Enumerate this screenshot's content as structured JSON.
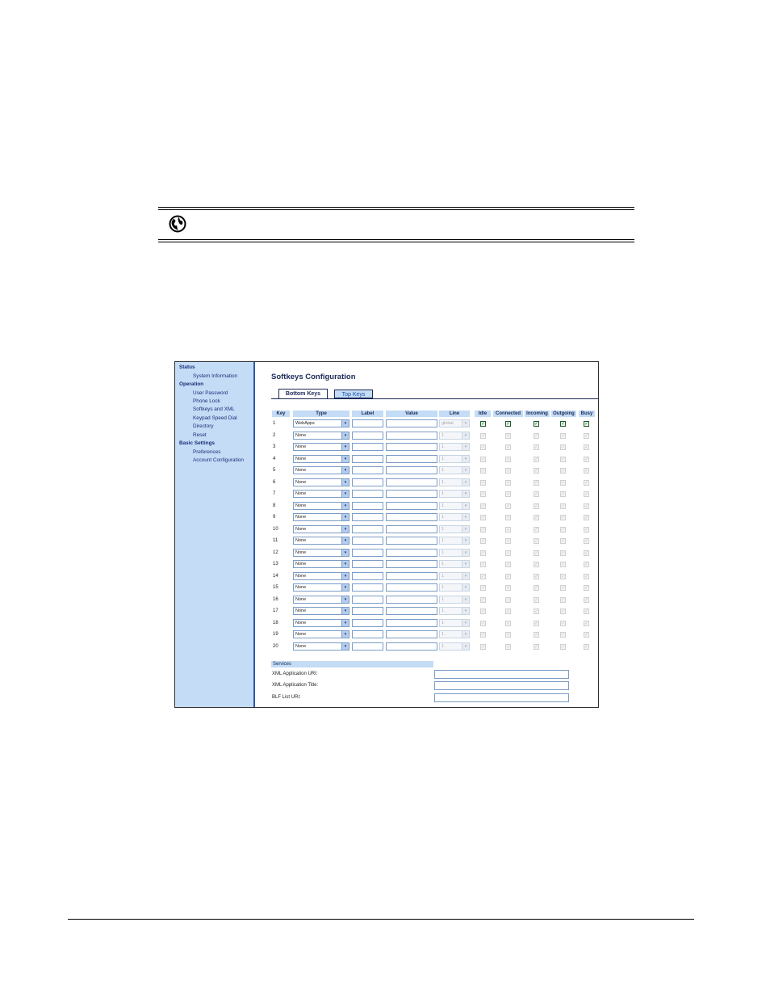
{
  "app": {
    "title": "Softkeys Configuration",
    "tabs": [
      {
        "label": "Bottom Keys",
        "active": true
      },
      {
        "label": "Top Keys",
        "active": false
      }
    ]
  },
  "sidebar": {
    "sections": [
      {
        "heading": "Status",
        "items": [
          "System Information"
        ]
      },
      {
        "heading": "Operation",
        "items": [
          "User Password",
          "Phone Lock",
          "Softkeys and XML",
          "Keypad Speed Dial",
          "Directory",
          "Reset"
        ]
      },
      {
        "heading": "Basic Settings",
        "items": [
          "Preferences",
          "Account Configuration"
        ]
      }
    ]
  },
  "table": {
    "headers": [
      "Key",
      "Type",
      "Label",
      "Value",
      "Line",
      "Idle",
      "Connected",
      "Incoming",
      "Outgoing",
      "Busy"
    ],
    "rows": [
      {
        "key": "1",
        "type": "WebApps",
        "line": "global",
        "enabled": true
      },
      {
        "key": "2",
        "type": "None",
        "line": "1",
        "enabled": false
      },
      {
        "key": "3",
        "type": "None",
        "line": "1",
        "enabled": false
      },
      {
        "key": "4",
        "type": "None",
        "line": "1",
        "enabled": false
      },
      {
        "key": "5",
        "type": "None",
        "line": "1",
        "enabled": false
      },
      {
        "key": "6",
        "type": "None",
        "line": "1",
        "enabled": false
      },
      {
        "key": "7",
        "type": "None",
        "line": "1",
        "enabled": false
      },
      {
        "key": "8",
        "type": "None",
        "line": "1",
        "enabled": false
      },
      {
        "key": "9",
        "type": "None",
        "line": "1",
        "enabled": false
      },
      {
        "key": "10",
        "type": "None",
        "line": "1",
        "enabled": false
      },
      {
        "key": "11",
        "type": "None",
        "line": "1",
        "enabled": false
      },
      {
        "key": "12",
        "type": "None",
        "line": "1",
        "enabled": false
      },
      {
        "key": "13",
        "type": "None",
        "line": "1",
        "enabled": false
      },
      {
        "key": "14",
        "type": "None",
        "line": "1",
        "enabled": false
      },
      {
        "key": "15",
        "type": "None",
        "line": "1",
        "enabled": false
      },
      {
        "key": "16",
        "type": "None",
        "line": "1",
        "enabled": false
      },
      {
        "key": "17",
        "type": "None",
        "line": "1",
        "enabled": false
      },
      {
        "key": "18",
        "type": "None",
        "line": "1",
        "enabled": false
      },
      {
        "key": "19",
        "type": "None",
        "line": "1",
        "enabled": false
      },
      {
        "key": "20",
        "type": "None",
        "line": "1",
        "enabled": false
      }
    ]
  },
  "services": {
    "heading": "Services",
    "fields": [
      {
        "label": "XML Application URI:",
        "value": ""
      },
      {
        "label": "XML Application Title:",
        "value": ""
      },
      {
        "label": "BLF List URI:",
        "value": ""
      }
    ]
  },
  "icons": {
    "note": "globe-icon",
    "dropdown": "chevron-down-icon",
    "check": "checkmark-icon"
  },
  "colors": {
    "nav_bg": "#c4dcf5",
    "accent": "#1b2a57",
    "check": "#1c7a2a"
  }
}
